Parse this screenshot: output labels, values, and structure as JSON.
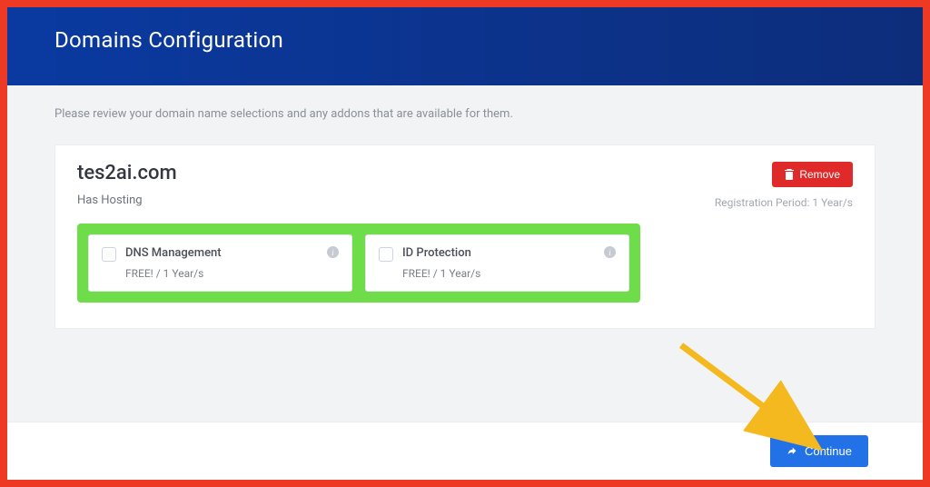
{
  "header": {
    "title": "Domains Configuration"
  },
  "review_text": "Please review your domain name selections and any addons that are available for them.",
  "domain": {
    "name": "tes2ai.com",
    "hosting_label": "Has Hosting",
    "remove_label": "Remove",
    "reg_period_label": "Registration Period: 1 Year/s"
  },
  "addons": [
    {
      "title": "DNS Management",
      "price": "FREE! / 1 Year/s"
    },
    {
      "title": "ID Protection",
      "price": "FREE! / 1 Year/s"
    }
  ],
  "footer": {
    "continue_label": "Continue"
  },
  "colors": {
    "frame_highlight": "#ee3a24",
    "addon_highlight": "#6fdc4a",
    "arrow": "#f5b920"
  }
}
